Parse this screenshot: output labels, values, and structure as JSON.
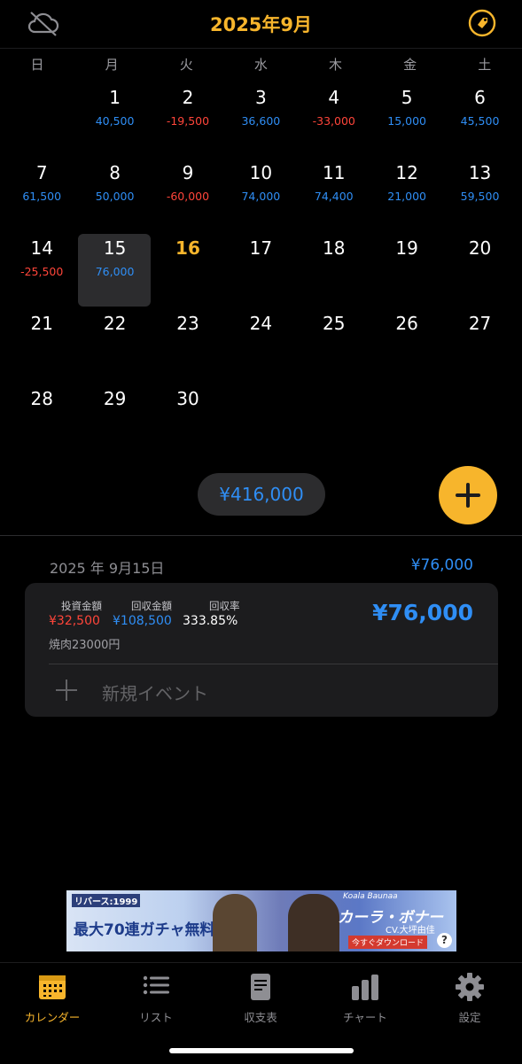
{
  "header": {
    "title": "2025年9月",
    "left_icon": "cloud-off-icon",
    "right_icon": "tag-icon"
  },
  "weekdays": [
    "日",
    "月",
    "火",
    "水",
    "木",
    "金",
    "土"
  ],
  "weeks": [
    [
      {
        "day": "",
        "amount": ""
      },
      {
        "day": "1",
        "amount": "40,500"
      },
      {
        "day": "2",
        "amount": "-19,500"
      },
      {
        "day": "3",
        "amount": "36,600"
      },
      {
        "day": "4",
        "amount": "-33,000"
      },
      {
        "day": "5",
        "amount": "15,000"
      },
      {
        "day": "6",
        "amount": "45,500"
      }
    ],
    [
      {
        "day": "7",
        "amount": "61,500"
      },
      {
        "day": "8",
        "amount": "50,000"
      },
      {
        "day": "9",
        "amount": "-60,000"
      },
      {
        "day": "10",
        "amount": "74,000"
      },
      {
        "day": "11",
        "amount": "74,400"
      },
      {
        "day": "12",
        "amount": "21,000"
      },
      {
        "day": "13",
        "amount": "59,500"
      }
    ],
    [
      {
        "day": "14",
        "amount": "-25,500"
      },
      {
        "day": "15",
        "amount": "76,000"
      },
      {
        "day": "16",
        "amount": ""
      },
      {
        "day": "17",
        "amount": ""
      },
      {
        "day": "18",
        "amount": ""
      },
      {
        "day": "19",
        "amount": ""
      },
      {
        "day": "20",
        "amount": ""
      }
    ],
    [
      {
        "day": "21",
        "amount": ""
      },
      {
        "day": "22",
        "amount": ""
      },
      {
        "day": "23",
        "amount": ""
      },
      {
        "day": "24",
        "amount": ""
      },
      {
        "day": "25",
        "amount": ""
      },
      {
        "day": "26",
        "amount": ""
      },
      {
        "day": "27",
        "amount": ""
      }
    ],
    [
      {
        "day": "28",
        "amount": ""
      },
      {
        "day": "29",
        "amount": ""
      },
      {
        "day": "30",
        "amount": ""
      },
      {
        "day": "",
        "amount": ""
      },
      {
        "day": "",
        "amount": ""
      },
      {
        "day": "",
        "amount": ""
      },
      {
        "day": "",
        "amount": ""
      }
    ]
  ],
  "selected_day": "15",
  "today": "16",
  "month_total": "¥416,000",
  "detail": {
    "date": "2025 年 9月15日",
    "total": "¥76,000",
    "event": {
      "invest_label": "投資金額",
      "invest_value": "¥32,500",
      "return_label": "回収金額",
      "return_value": "¥108,500",
      "rate_label": "回収率",
      "rate_value": "333.85%",
      "note": "焼肉23000円",
      "amount": "¥76,000"
    },
    "new_event_label": "新規イベント"
  },
  "ad": {
    "brand": "リバース:1999",
    "promo": "最大70連ガチャ無料!",
    "tagline": "Koala Baunaa",
    "character": "カーラ・ボナー",
    "cv": "CV.大坪由佳",
    "cta": "今すぐダウンロード",
    "help": "?"
  },
  "tabs": [
    {
      "label": "カレンダー",
      "icon": "calendar-icon",
      "active": true
    },
    {
      "label": "リスト",
      "icon": "list-icon",
      "active": false
    },
    {
      "label": "収支表",
      "icon": "document-icon",
      "active": false
    },
    {
      "label": "チャート",
      "icon": "bar-chart-icon",
      "active": false
    },
    {
      "label": "設定",
      "icon": "gear-icon",
      "active": false
    }
  ],
  "colors": {
    "accent": "#f7b52c",
    "positive": "#2f8ef5",
    "negative": "#ff453a",
    "surface": "#1c1c1e"
  }
}
